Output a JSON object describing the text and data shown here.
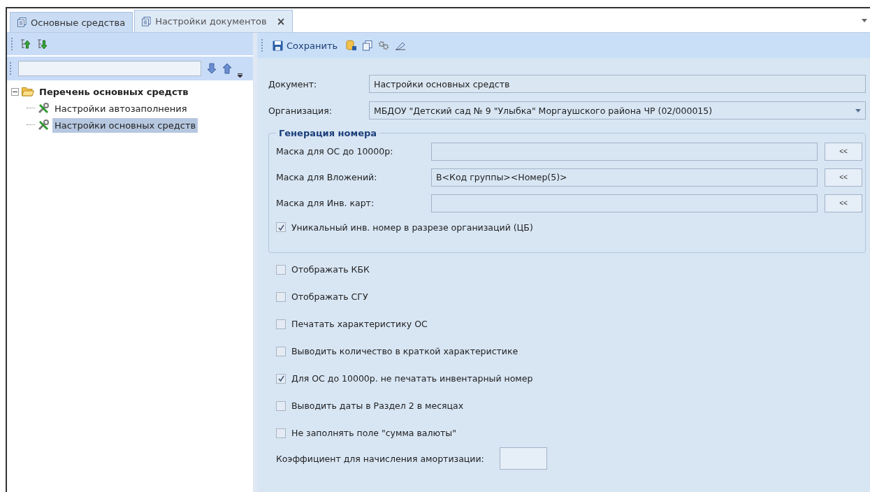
{
  "tabs": [
    {
      "label": "Основные средства",
      "selected": false
    },
    {
      "label": "Настройки документов",
      "selected": true,
      "close": "×"
    }
  ],
  "tree": {
    "items": [
      {
        "label": "Перечень основных средств",
        "expanded": true,
        "selected": false,
        "children": [
          {
            "label": "Настройки автозаполнения",
            "selected": false
          },
          {
            "label": "Настройки основных средств",
            "selected": true
          }
        ]
      }
    ]
  },
  "toolbar": {
    "save": "Сохранить"
  },
  "fields": [
    {
      "label": "Документ:",
      "value": "Настройки основных средств",
      "kind": "text"
    },
    {
      "label": "Организация:",
      "value": "МБДОУ \"Детский сад № 9 \"Улыбка\" Моргаушского района ЧР (02/000015)",
      "kind": "dropdown"
    }
  ],
  "number_generation": {
    "title": "Генерация номера",
    "masks": [
      {
        "label": "Маска для ОС до 10000р:",
        "button": "<<"
      },
      {
        "label": "Маска для Вложений:",
        "value": "В<Код группы><Номер(5)>",
        "button": "<<"
      },
      {
        "label": "Маска для Инв. карт:",
        "button": "<<"
      }
    ],
    "unique": {
      "label": "Уникальный инв. номер в разрезе организаций (ЦБ)",
      "checked": true
    }
  },
  "options": [
    {
      "label": "Отображать КБК",
      "checked": false
    },
    {
      "label": "Отображать СГУ",
      "checked": false
    },
    {
      "label": "Печатать характеристику ОС",
      "checked": false
    },
    {
      "label": "Выводить количество в краткой характеристике",
      "checked": false
    },
    {
      "label": "Для ОС до 10000р. не печатать инвентарный номер",
      "checked": true
    },
    {
      "label": "Выводить даты в Раздел 2 в месяцах",
      "checked": false
    },
    {
      "label": "Не заполнять поле \"сумма валюты\"",
      "checked": false
    }
  ],
  "coefficient": {
    "label": "Коэффициент для начисления амортизации:"
  }
}
